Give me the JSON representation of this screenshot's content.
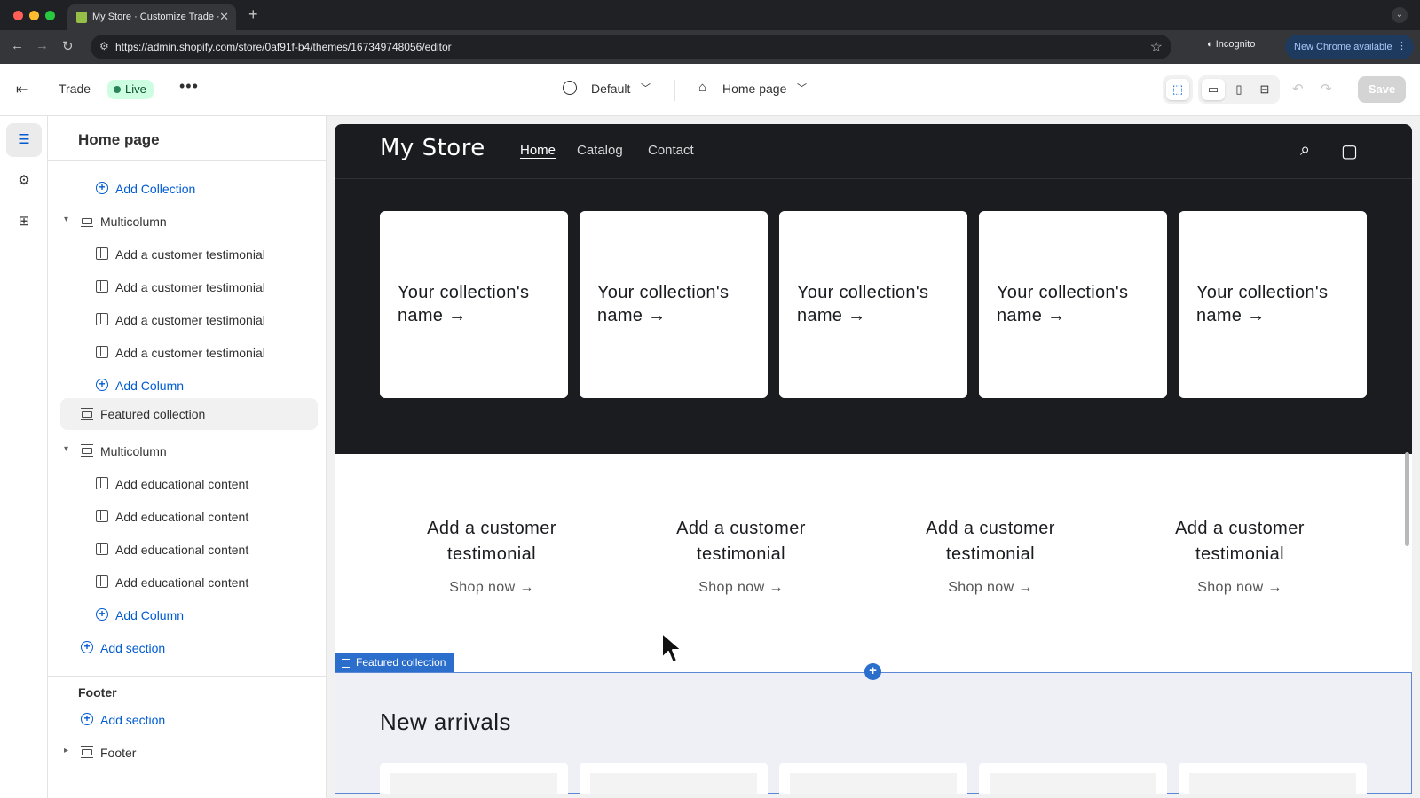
{
  "browser": {
    "tab_title": "My Store · Customize Trade ·",
    "url": "https://admin.shopify.com/store/0af91f-b4/themes/167349748056/editor",
    "incognito_label": "Incognito",
    "new_chrome_label": "New Chrome available"
  },
  "editor": {
    "theme_name": "Trade",
    "live_badge": "Live",
    "locale_select": "Default",
    "page_select": "Home page",
    "save_label": "Save"
  },
  "sidebar": {
    "title": "Home page",
    "add_collection": "Add Collection",
    "multicolumn_1": {
      "label": "Multicolumn",
      "blocks": [
        "Add a customer testimonial",
        "Add a customer testimonial",
        "Add a customer testimonial",
        "Add a customer testimonial"
      ],
      "add_column": "Add Column"
    },
    "featured_collection": "Featured collection",
    "multicolumn_2": {
      "label": "Multicolumn",
      "blocks": [
        "Add educational content",
        "Add educational content",
        "Add educational content",
        "Add educational content"
      ],
      "add_column": "Add Column"
    },
    "add_section": "Add section",
    "footer_heading": "Footer",
    "footer_add_section": "Add section",
    "footer_group": "Footer"
  },
  "store": {
    "logo": "My Store",
    "nav": [
      "Home",
      "Catalog",
      "Contact"
    ],
    "collections": [
      "Your collection's name →",
      "Your collection's name →",
      "Your collection's name →",
      "Your collection's name →",
      "Your collection's name →"
    ],
    "testimonials": [
      {
        "title": "Add a customer testimonial",
        "link": "Shop now →"
      },
      {
        "title": "Add a customer testimonial",
        "link": "Shop now →"
      },
      {
        "title": "Add a customer testimonial",
        "link": "Shop now →"
      },
      {
        "title": "Add a customer testimonial",
        "link": "Shop now →"
      }
    ],
    "featured_tag": "Featured collection",
    "featured_heading": "New arrivals"
  },
  "colors": {
    "accent": "#005bd3",
    "live_badge_bg": "#cdfee1",
    "store_dark_bg": "#1b1c20",
    "selection_blue": "#2c6ecb"
  }
}
